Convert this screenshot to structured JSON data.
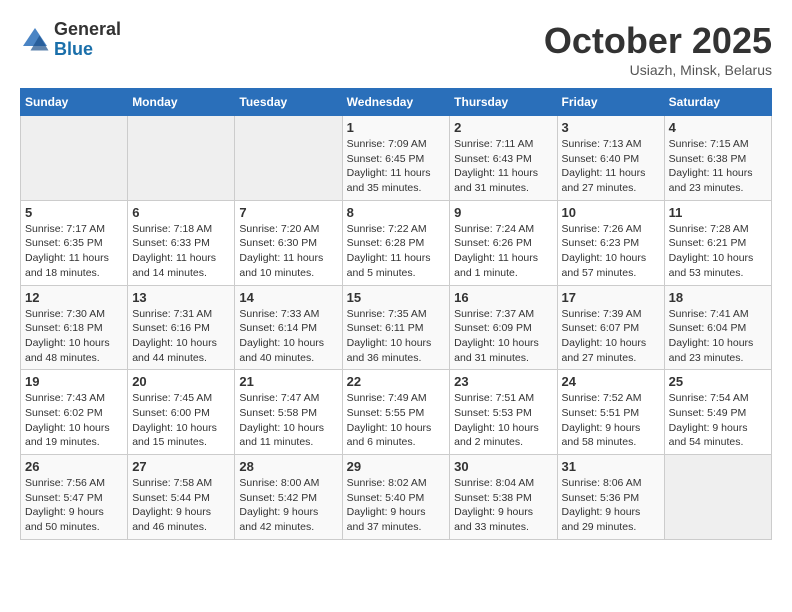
{
  "header": {
    "logo_general": "General",
    "logo_blue": "Blue",
    "month_title": "October 2025",
    "location": "Usiazh, Minsk, Belarus"
  },
  "weekdays": [
    "Sunday",
    "Monday",
    "Tuesday",
    "Wednesday",
    "Thursday",
    "Friday",
    "Saturday"
  ],
  "weeks": [
    [
      {
        "day": "",
        "info": ""
      },
      {
        "day": "",
        "info": ""
      },
      {
        "day": "",
        "info": ""
      },
      {
        "day": "1",
        "info": "Sunrise: 7:09 AM\nSunset: 6:45 PM\nDaylight: 11 hours\nand 35 minutes."
      },
      {
        "day": "2",
        "info": "Sunrise: 7:11 AM\nSunset: 6:43 PM\nDaylight: 11 hours\nand 31 minutes."
      },
      {
        "day": "3",
        "info": "Sunrise: 7:13 AM\nSunset: 6:40 PM\nDaylight: 11 hours\nand 27 minutes."
      },
      {
        "day": "4",
        "info": "Sunrise: 7:15 AM\nSunset: 6:38 PM\nDaylight: 11 hours\nand 23 minutes."
      }
    ],
    [
      {
        "day": "5",
        "info": "Sunrise: 7:17 AM\nSunset: 6:35 PM\nDaylight: 11 hours\nand 18 minutes."
      },
      {
        "day": "6",
        "info": "Sunrise: 7:18 AM\nSunset: 6:33 PM\nDaylight: 11 hours\nand 14 minutes."
      },
      {
        "day": "7",
        "info": "Sunrise: 7:20 AM\nSunset: 6:30 PM\nDaylight: 11 hours\nand 10 minutes."
      },
      {
        "day": "8",
        "info": "Sunrise: 7:22 AM\nSunset: 6:28 PM\nDaylight: 11 hours\nand 5 minutes."
      },
      {
        "day": "9",
        "info": "Sunrise: 7:24 AM\nSunset: 6:26 PM\nDaylight: 11 hours\nand 1 minute."
      },
      {
        "day": "10",
        "info": "Sunrise: 7:26 AM\nSunset: 6:23 PM\nDaylight: 10 hours\nand 57 minutes."
      },
      {
        "day": "11",
        "info": "Sunrise: 7:28 AM\nSunset: 6:21 PM\nDaylight: 10 hours\nand 53 minutes."
      }
    ],
    [
      {
        "day": "12",
        "info": "Sunrise: 7:30 AM\nSunset: 6:18 PM\nDaylight: 10 hours\nand 48 minutes."
      },
      {
        "day": "13",
        "info": "Sunrise: 7:31 AM\nSunset: 6:16 PM\nDaylight: 10 hours\nand 44 minutes."
      },
      {
        "day": "14",
        "info": "Sunrise: 7:33 AM\nSunset: 6:14 PM\nDaylight: 10 hours\nand 40 minutes."
      },
      {
        "day": "15",
        "info": "Sunrise: 7:35 AM\nSunset: 6:11 PM\nDaylight: 10 hours\nand 36 minutes."
      },
      {
        "day": "16",
        "info": "Sunrise: 7:37 AM\nSunset: 6:09 PM\nDaylight: 10 hours\nand 31 minutes."
      },
      {
        "day": "17",
        "info": "Sunrise: 7:39 AM\nSunset: 6:07 PM\nDaylight: 10 hours\nand 27 minutes."
      },
      {
        "day": "18",
        "info": "Sunrise: 7:41 AM\nSunset: 6:04 PM\nDaylight: 10 hours\nand 23 minutes."
      }
    ],
    [
      {
        "day": "19",
        "info": "Sunrise: 7:43 AM\nSunset: 6:02 PM\nDaylight: 10 hours\nand 19 minutes."
      },
      {
        "day": "20",
        "info": "Sunrise: 7:45 AM\nSunset: 6:00 PM\nDaylight: 10 hours\nand 15 minutes."
      },
      {
        "day": "21",
        "info": "Sunrise: 7:47 AM\nSunset: 5:58 PM\nDaylight: 10 hours\nand 11 minutes."
      },
      {
        "day": "22",
        "info": "Sunrise: 7:49 AM\nSunset: 5:55 PM\nDaylight: 10 hours\nand 6 minutes."
      },
      {
        "day": "23",
        "info": "Sunrise: 7:51 AM\nSunset: 5:53 PM\nDaylight: 10 hours\nand 2 minutes."
      },
      {
        "day": "24",
        "info": "Sunrise: 7:52 AM\nSunset: 5:51 PM\nDaylight: 9 hours\nand 58 minutes."
      },
      {
        "day": "25",
        "info": "Sunrise: 7:54 AM\nSunset: 5:49 PM\nDaylight: 9 hours\nand 54 minutes."
      }
    ],
    [
      {
        "day": "26",
        "info": "Sunrise: 7:56 AM\nSunset: 5:47 PM\nDaylight: 9 hours\nand 50 minutes."
      },
      {
        "day": "27",
        "info": "Sunrise: 7:58 AM\nSunset: 5:44 PM\nDaylight: 9 hours\nand 46 minutes."
      },
      {
        "day": "28",
        "info": "Sunrise: 8:00 AM\nSunset: 5:42 PM\nDaylight: 9 hours\nand 42 minutes."
      },
      {
        "day": "29",
        "info": "Sunrise: 8:02 AM\nSunset: 5:40 PM\nDaylight: 9 hours\nand 37 minutes."
      },
      {
        "day": "30",
        "info": "Sunrise: 8:04 AM\nSunset: 5:38 PM\nDaylight: 9 hours\nand 33 minutes."
      },
      {
        "day": "31",
        "info": "Sunrise: 8:06 AM\nSunset: 5:36 PM\nDaylight: 9 hours\nand 29 minutes."
      },
      {
        "day": "",
        "info": ""
      }
    ]
  ]
}
